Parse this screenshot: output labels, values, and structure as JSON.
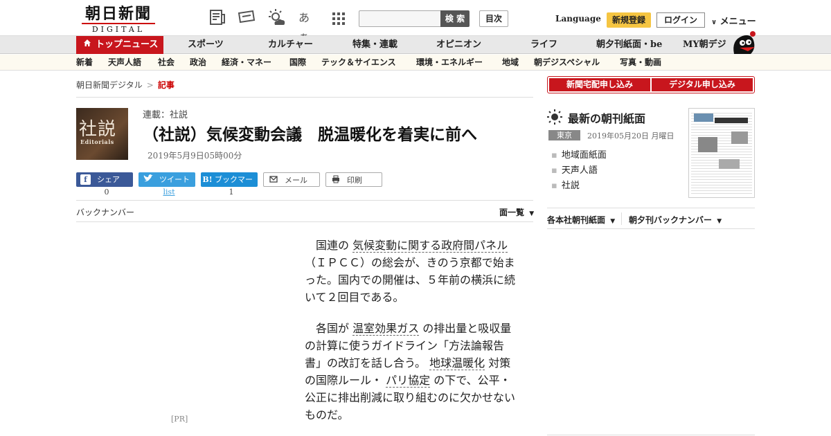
{
  "header": {
    "logo_jp": "朝日新聞",
    "logo_en": "DIGITAL",
    "font_icon_label": "あぁ",
    "search_placeholder": "",
    "search_button": "検 索",
    "index_button": "目次",
    "language": "Language",
    "register": "新規登録",
    "login": "ログイン",
    "menu": "メニュー"
  },
  "nav": {
    "top": "トップニュース",
    "items": [
      "スポーツ",
      "カルチャー",
      "特集・連載",
      "オピニオン",
      "ライフ",
      "朝夕刊紙面・be",
      "MY朝デジ"
    ]
  },
  "subnav": {
    "items": [
      "新着",
      "天声人語",
      "社会",
      "政治",
      "経済・マネー",
      "国際",
      "テック＆サイエンス",
      "環境・エネルギー",
      "地域",
      "朝デジスペシャル",
      "写真・動画"
    ]
  },
  "breadcrumb": {
    "home": "朝日新聞デジタル",
    "sep": ">",
    "current": "記事"
  },
  "article": {
    "image_kanji": "社説",
    "image_en": "Editorials",
    "series": "連載：社説",
    "title": "（社説）気候変動会議　脱温暖化を着実に前へ",
    "date": "2019年5月9日05時00分",
    "share": {
      "fb": "シェア",
      "fb_count": "0",
      "tw": "ツイート",
      "tw_count": "list",
      "hb": "ブックマーク",
      "hb_count": "1",
      "mail": "メール",
      "print": "印刷"
    },
    "backnumber": "バックナンバー",
    "list_all": "面一覧",
    "pr": "[PR]",
    "p1_a": "国連の",
    "p1_kw": "気候変動に関する政府間パネル",
    "p1_b": "（ＩＰＣＣ）の総会が、きのう京都で始まった。国内での開催は、５年前の横浜に続いて２回目である。",
    "p2_a": "各国が",
    "p2_kw1": "温室効果ガス",
    "p2_b": "の排出量と吸収量の計算に使うガイドライン「方法論報告書」の改訂を話し合う。",
    "p2_kw2": "地球温暖化",
    "p2_c": "対策の国際ルール・",
    "p2_kw3": "パリ協定",
    "p2_d": "の下で、公平・公正に排出削減に取り組むのに欠かせないものだ。"
  },
  "right": {
    "btn_delivery": "新聞宅配申し込み",
    "btn_digital": "デジタル申し込み",
    "latest_title": "最新の朝刊紙面",
    "edition": "東京",
    "edition_date": "2019年05月20日 月曜日",
    "links": [
      "地域面紙面",
      "天声人語",
      "社説"
    ],
    "bottom_a": "各本社朝刊紙面",
    "bottom_b": "朝夕刊バックナンバー"
  }
}
